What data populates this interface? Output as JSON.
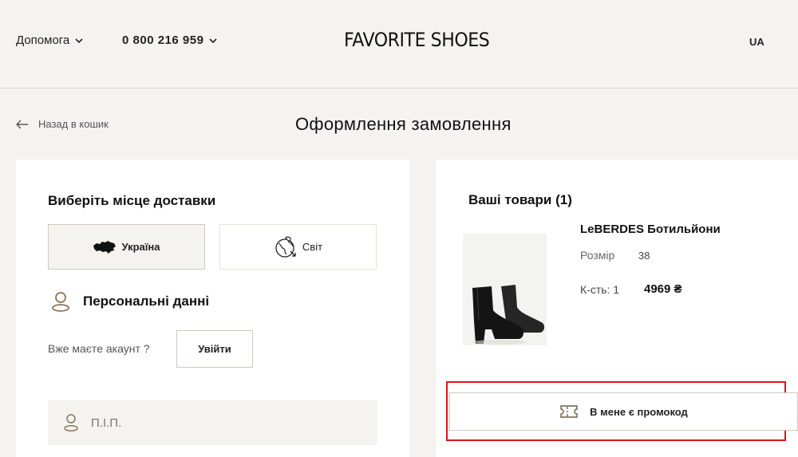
{
  "header": {
    "help_label": "Допомога",
    "phone": "0 800 216 959",
    "logo": "FAVORITE SHOES",
    "lang": "UA"
  },
  "page": {
    "back_label": "Назад в кошик",
    "title": "Оформлення замовлення"
  },
  "delivery": {
    "heading": "Виберіть місце доставки",
    "options": [
      {
        "label": "Україна",
        "icon": "ukraine-map-icon",
        "selected": true
      },
      {
        "label": "Світ",
        "icon": "globe-icon",
        "selected": false
      }
    ]
  },
  "personal": {
    "heading": "Персональні данні",
    "have_account": "Вже маєте акаунт ?",
    "login_label": "Увійти",
    "name_placeholder": "П.І.П."
  },
  "cart": {
    "heading": "Ваші товари (1)",
    "item": {
      "name": "LeBERDES Ботильйони",
      "size_label": "Розмір",
      "size_value": "38",
      "qty_label": "К-сть: 1",
      "price": "4969 ₴"
    },
    "promo_label": "В мене є промокод"
  },
  "colors": {
    "background": "#f4f3ef",
    "panel": "#ffffff",
    "highlight": "#e0141b"
  }
}
